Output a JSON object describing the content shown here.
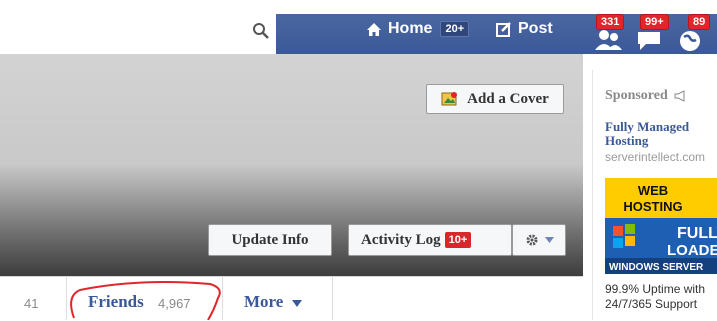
{
  "topnav": {
    "home_label": "Home",
    "home_count": "20+",
    "post_label": "Post",
    "friend_requests_badge": "331",
    "messages_badge": "99+",
    "notifications_badge": "89"
  },
  "cover": {
    "add_cover_label": "Add a Cover",
    "update_info_label": "Update Info",
    "activity_log_label": "Activity Log",
    "activity_log_badge": "10+"
  },
  "tabs": {
    "left_count": "41",
    "friends_label": "Friends",
    "friends_count": "4,967",
    "more_label": "More"
  },
  "sidebar": {
    "sponsored_label": "Sponsored",
    "ad_title_line1": "Fully Managed",
    "ad_title_line2": "Hosting",
    "ad_domain": "serverintellect.com",
    "ad_image_line1": "WEB",
    "ad_image_line2": "HOSTING",
    "ad_image_line3": "FULLY",
    "ad_image_line4": "LOADED",
    "ad_image_line5": "WINDOWS SERVER",
    "ad_text_line1": "99.9% Uptime with",
    "ad_text_line2": "24/7/365 Support"
  },
  "colors": {
    "facebook_blue": "#3b5998",
    "badge_red": "#e0252b",
    "annotation_red": "#e0252b"
  }
}
